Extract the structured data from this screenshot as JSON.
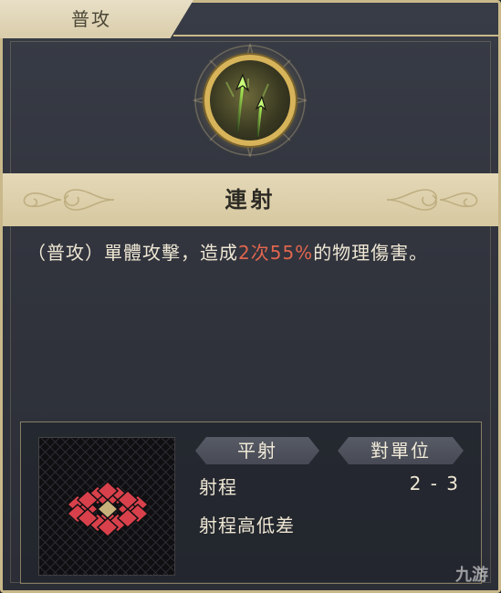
{
  "category_tab": {
    "label": "普攻"
  },
  "skill": {
    "icon": "twin-arrows-icon",
    "name": "連射",
    "description": {
      "prefix": "（普攻）單體攻擊，造成",
      "hit_count": "2次",
      "percent": "55%",
      "suffix": "的物理傷害。"
    }
  },
  "attributes": {
    "attack_type": "平射",
    "target_type": "對單位",
    "stats": [
      {
        "label": "射程",
        "value": "2 - 3"
      },
      {
        "label": "射程高低差",
        "value": ""
      }
    ]
  },
  "colors": {
    "accent_gold": "#c9b88a",
    "highlight_red": "#e0664e",
    "range_tile": "#d8414b",
    "range_center": "#c8b27c"
  },
  "watermark": {
    "text": "九游"
  }
}
